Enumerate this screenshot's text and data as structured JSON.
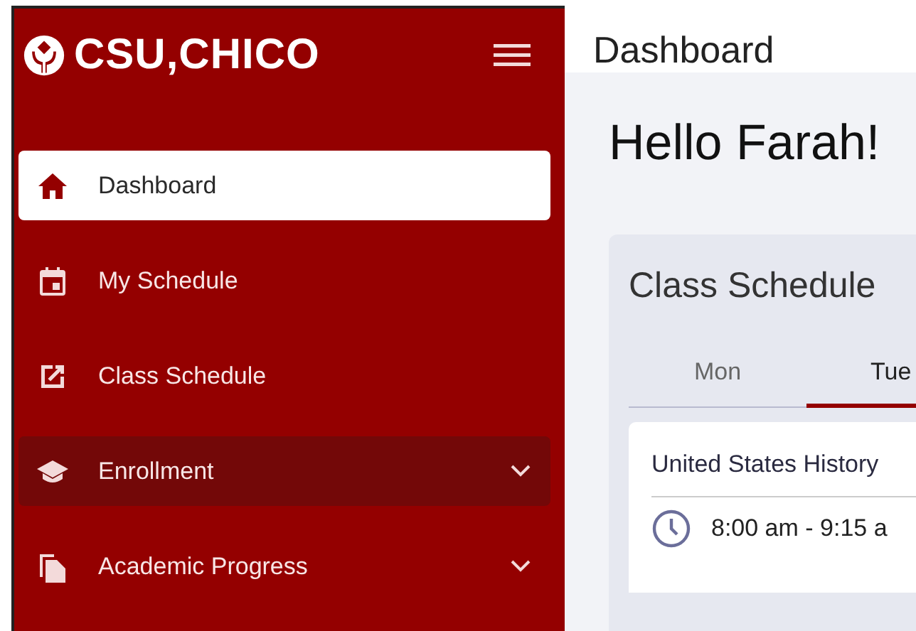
{
  "sidebar": {
    "logo": "CSU,CHICO",
    "items": [
      {
        "label": "Dashboard",
        "kind": "home",
        "selected": true,
        "highlighted": false,
        "expandable": false
      },
      {
        "label": "My Schedule",
        "kind": "calendar",
        "selected": false,
        "highlighted": false,
        "expandable": false
      },
      {
        "label": "Class Schedule",
        "kind": "external",
        "selected": false,
        "highlighted": false,
        "expandable": false
      },
      {
        "label": "Enrollment",
        "kind": "cap",
        "selected": false,
        "highlighted": true,
        "expandable": true
      },
      {
        "label": "Academic Progress",
        "kind": "documents",
        "selected": false,
        "highlighted": false,
        "expandable": true
      }
    ]
  },
  "header": {
    "title": "Dashboard"
  },
  "greeting": "Hello Farah!",
  "schedule_card": {
    "title": "Class Schedule",
    "tabs": [
      {
        "label": "Mon",
        "selected": false
      },
      {
        "label": "Tue",
        "selected": true
      }
    ],
    "class": {
      "name": "United States History",
      "time": "8:00 am - 9:15 a"
    }
  }
}
